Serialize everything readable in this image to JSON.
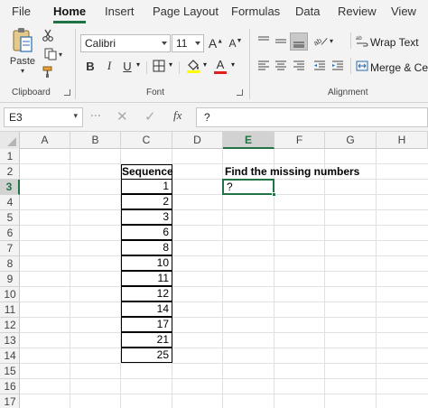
{
  "menu": {
    "tabs": [
      "File",
      "Home",
      "Insert",
      "Page Layout",
      "Formulas",
      "Data",
      "Review",
      "View"
    ],
    "active": "Home"
  },
  "ribbon": {
    "clipboard": {
      "paste_label": "Paste",
      "group_label": "Clipboard"
    },
    "font": {
      "name": "Calibri",
      "size": "11",
      "bold": "B",
      "italic": "I",
      "underline": "U",
      "group_label": "Font",
      "font_color": "#e0201b"
    },
    "alignment": {
      "wrap_text": "Wrap Text",
      "merge": "Merge & Center",
      "group_label": "Alignment"
    }
  },
  "formula_bar": {
    "name_box": "E3",
    "fx": "fx",
    "formula": "?"
  },
  "grid": {
    "columns": [
      "A",
      "B",
      "C",
      "D",
      "E",
      "F",
      "G",
      "H"
    ],
    "selected_column": "E",
    "rows": [
      "1",
      "2",
      "3",
      "4",
      "5",
      "6",
      "7",
      "8",
      "9",
      "10",
      "11",
      "12",
      "13",
      "14",
      "15",
      "16",
      "17"
    ],
    "selected_row": "3"
  },
  "sheet": {
    "sequence_header": "Sequence",
    "sequence_values": [
      "1",
      "2",
      "3",
      "6",
      "8",
      "10",
      "11",
      "12",
      "14",
      "17",
      "21",
      "25"
    ],
    "task_title": "Find the missing numbers",
    "active_cell_value": "?"
  },
  "colors": {
    "accent": "#217346"
  }
}
